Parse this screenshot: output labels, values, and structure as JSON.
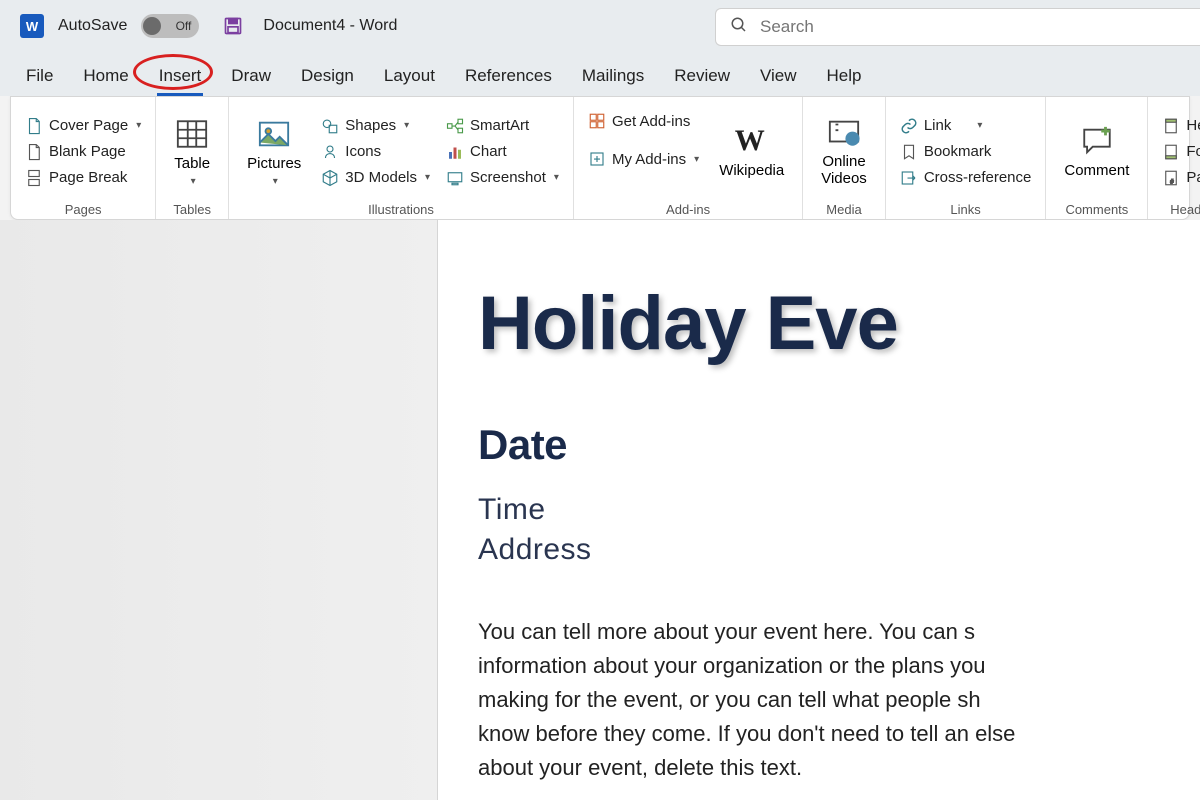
{
  "titlebar": {
    "autosave_label": "AutoSave",
    "toggle_state": "Off",
    "document_title": "Document4  -  Word"
  },
  "search": {
    "placeholder": "Search"
  },
  "tabs": {
    "file": "File",
    "home": "Home",
    "insert": "Insert",
    "draw": "Draw",
    "design": "Design",
    "layout": "Layout",
    "references": "References",
    "mailings": "Mailings",
    "review": "Review",
    "view": "View",
    "help": "Help",
    "active": "insert"
  },
  "ribbon": {
    "pages": {
      "label": "Pages",
      "cover_page": "Cover Page",
      "blank_page": "Blank Page",
      "page_break": "Page Break"
    },
    "tables": {
      "label": "Tables",
      "table": "Table"
    },
    "illustrations": {
      "label": "Illustrations",
      "pictures": "Pictures",
      "shapes": "Shapes",
      "icons": "Icons",
      "models_3d": "3D Models",
      "smartart": "SmartArt",
      "chart": "Chart",
      "screenshot": "Screenshot"
    },
    "addins": {
      "label": "Add-ins",
      "get_addins": "Get Add-ins",
      "my_addins": "My Add-ins",
      "wikipedia": "Wikipedia"
    },
    "media": {
      "label": "Media",
      "online_videos": "Online\nVideos"
    },
    "links": {
      "label": "Links",
      "link": "Link",
      "bookmark": "Bookmark",
      "cross_reference": "Cross-reference"
    },
    "comments": {
      "label": "Comments",
      "comment": "Comment"
    },
    "header_footer": {
      "label": "Heade",
      "header": "Hea",
      "footer": "Foot",
      "page_number": "Pag"
    }
  },
  "document": {
    "title": "Holiday Eve",
    "date": "Date",
    "time": "Time",
    "address": "Address",
    "body": "You can tell more about your event here. You can s information about your organization or the plans you making for the event, or you can tell what people sh know before they come. If you don't need to tell an else about your event, delete this text."
  }
}
